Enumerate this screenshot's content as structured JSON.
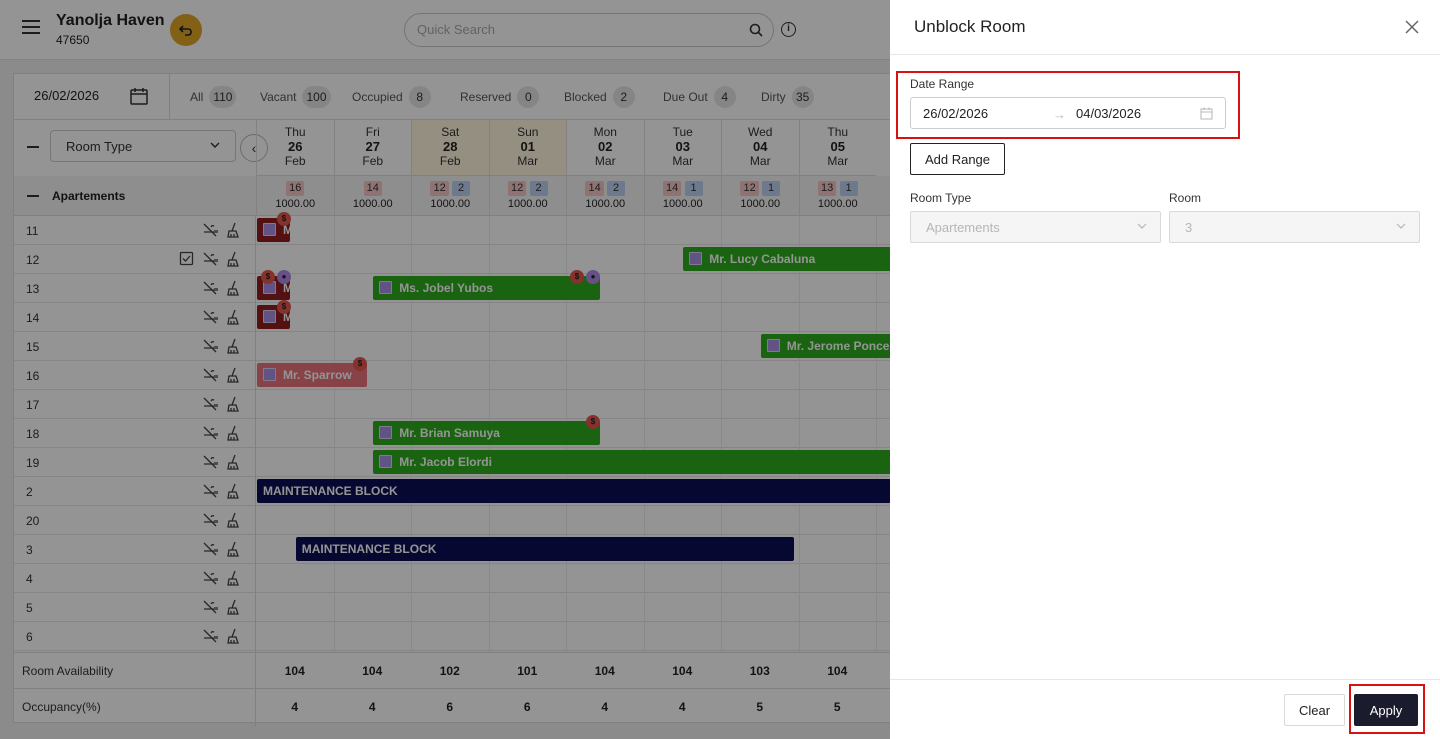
{
  "header": {
    "hotel_name": "Yanolja Haven",
    "hotel_id": "47650",
    "search_placeholder": "Quick Search"
  },
  "filters": {
    "date": "26/02/2026",
    "stats": [
      {
        "label": "All",
        "count": "110"
      },
      {
        "label": "Vacant",
        "count": "100"
      },
      {
        "label": "Occupied",
        "count": "8"
      },
      {
        "label": "Reserved",
        "count": "0"
      },
      {
        "label": "Blocked",
        "count": "2"
      },
      {
        "label": "Due Out",
        "count": "4"
      },
      {
        "label": "Dirty",
        "count": "35"
      }
    ],
    "room_type_select": "Room Type"
  },
  "days": [
    {
      "dow": "Thu",
      "day": "26",
      "month": "Feb",
      "weekend": false,
      "red": "16",
      "blue": "",
      "rate": "1000.00"
    },
    {
      "dow": "Fri",
      "day": "27",
      "month": "Feb",
      "weekend": false,
      "red": "14",
      "blue": "",
      "rate": "1000.00"
    },
    {
      "dow": "Sat",
      "day": "28",
      "month": "Feb",
      "weekend": true,
      "red": "12",
      "blue": "2",
      "rate": "1000.00"
    },
    {
      "dow": "Sun",
      "day": "01",
      "month": "Mar",
      "weekend": true,
      "red": "12",
      "blue": "2",
      "rate": "1000.00"
    },
    {
      "dow": "Mon",
      "day": "02",
      "month": "Mar",
      "weekend": false,
      "red": "14",
      "blue": "2",
      "rate": "1000.00"
    },
    {
      "dow": "Tue",
      "day": "03",
      "month": "Mar",
      "weekend": false,
      "red": "14",
      "blue": "1",
      "rate": "1000.00"
    },
    {
      "dow": "Wed",
      "day": "04",
      "month": "Mar",
      "weekend": false,
      "red": "12",
      "blue": "1",
      "rate": "1000.00"
    },
    {
      "dow": "Thu",
      "day": "05",
      "month": "Mar",
      "weekend": false,
      "red": "13",
      "blue": "1",
      "rate": "1000.00"
    }
  ],
  "group": {
    "label": "Apartements"
  },
  "rooms": [
    "11",
    "12",
    "13",
    "14",
    "15",
    "16",
    "17",
    "18",
    "19",
    "2",
    "20",
    "3",
    "4",
    "5",
    "6"
  ],
  "bookings": [
    {
      "guest": "M",
      "style": "dr",
      "row": 0,
      "start": 0.0,
      "span": 0.45
    },
    {
      "guest": "Mr. Lucy Cabaluna",
      "style": "g",
      "row": 1,
      "start": 5.5,
      "span": 3.0
    },
    {
      "guest": "M",
      "style": "dr",
      "row": 2,
      "start": 0.0,
      "span": 0.45
    },
    {
      "guest": "Ms. Jobel Yubos",
      "style": "g",
      "row": 2,
      "start": 1.5,
      "span": 2.95
    },
    {
      "guest": "M",
      "style": "dr",
      "row": 3,
      "start": 0.0,
      "span": 0.45
    },
    {
      "guest": "Mr. Jerome Ponce",
      "style": "g",
      "row": 4,
      "start": 6.5,
      "span": 2.0
    },
    {
      "guest": "Mr. Sparrow",
      "style": "pk",
      "row": 5,
      "start": 0.0,
      "span": 1.45
    },
    {
      "guest": "Mr. Brian Samuya",
      "style": "g",
      "row": 7,
      "start": 1.5,
      "span": 2.95
    },
    {
      "guest": "Mr. Jacob Elordi",
      "style": "g",
      "row": 8,
      "start": 1.5,
      "span": 7.0
    },
    {
      "guest": "MAINTENANCE BLOCK",
      "style": "nb",
      "row": 9,
      "start": 0.0,
      "span": 8.5
    },
    {
      "guest": "MAINTENANCE BLOCK",
      "style": "nb",
      "row": 11,
      "start": 0.5,
      "span": 6.45
    }
  ],
  "footer": {
    "availability_label": "Room Availability",
    "availability": [
      "104",
      "104",
      "102",
      "101",
      "104",
      "104",
      "103",
      "104"
    ],
    "occupancy_label": "Occupancy(%)",
    "occupancy": [
      "4",
      "4",
      "6",
      "6",
      "4",
      "4",
      "5",
      "5"
    ]
  },
  "drawer": {
    "title": "Unblock Room",
    "date_range_label": "Date Range",
    "start_date": "26/02/2026",
    "end_date": "04/03/2026",
    "add_range_label": "Add Range",
    "room_type_label": "Room Type",
    "room_type_value": "Apartements",
    "room_label": "Room",
    "room_value": "3",
    "clear_label": "Clear",
    "apply_label": "Apply"
  },
  "colors": {
    "accent": "#e0a526",
    "highlight": "#d81212",
    "apply_bg": "#1b1b2e",
    "booking_green": "#2eab1e",
    "booking_darkred": "#8f1e1e",
    "booking_pink": "#e9747a",
    "maintenance": "#0d0f55"
  }
}
